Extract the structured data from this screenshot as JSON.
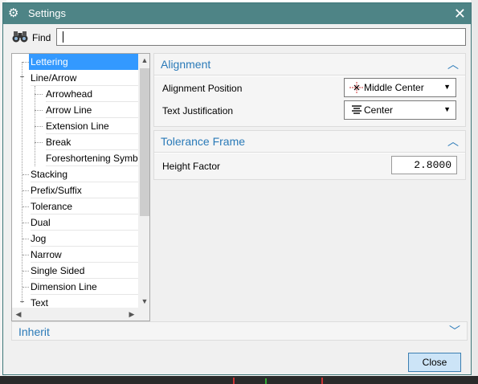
{
  "window": {
    "title": "Settings"
  },
  "find": {
    "label": "Find",
    "value": ""
  },
  "tree": {
    "items": [
      {
        "label": "Lettering",
        "selected": true
      },
      {
        "label": "Line/Arrow",
        "expanded": true
      },
      {
        "label": "Arrowhead"
      },
      {
        "label": "Arrow Line"
      },
      {
        "label": "Extension Line"
      },
      {
        "label": "Break"
      },
      {
        "label": "Foreshortening Symb"
      },
      {
        "label": "Stacking"
      },
      {
        "label": "Prefix/Suffix"
      },
      {
        "label": "Tolerance"
      },
      {
        "label": "Dual"
      },
      {
        "label": "Jog"
      },
      {
        "label": "Narrow"
      },
      {
        "label": "Single Sided"
      },
      {
        "label": "Dimension Line"
      },
      {
        "label": "Text",
        "expanded": true
      }
    ]
  },
  "alignment": {
    "title": "Alignment",
    "position_label": "Alignment Position",
    "position_value": "Middle Center",
    "justification_label": "Text Justification",
    "justification_value": "Center"
  },
  "tolerance_frame": {
    "title": "Tolerance Frame",
    "height_factor_label": "Height Factor",
    "height_factor_value": "2.8000"
  },
  "inherit": {
    "title": "Inherit"
  },
  "buttons": {
    "close": "Close"
  },
  "colors": {
    "titlebar": "#4e8486",
    "accent": "#2a7ab8",
    "selection": "#3399ff"
  }
}
